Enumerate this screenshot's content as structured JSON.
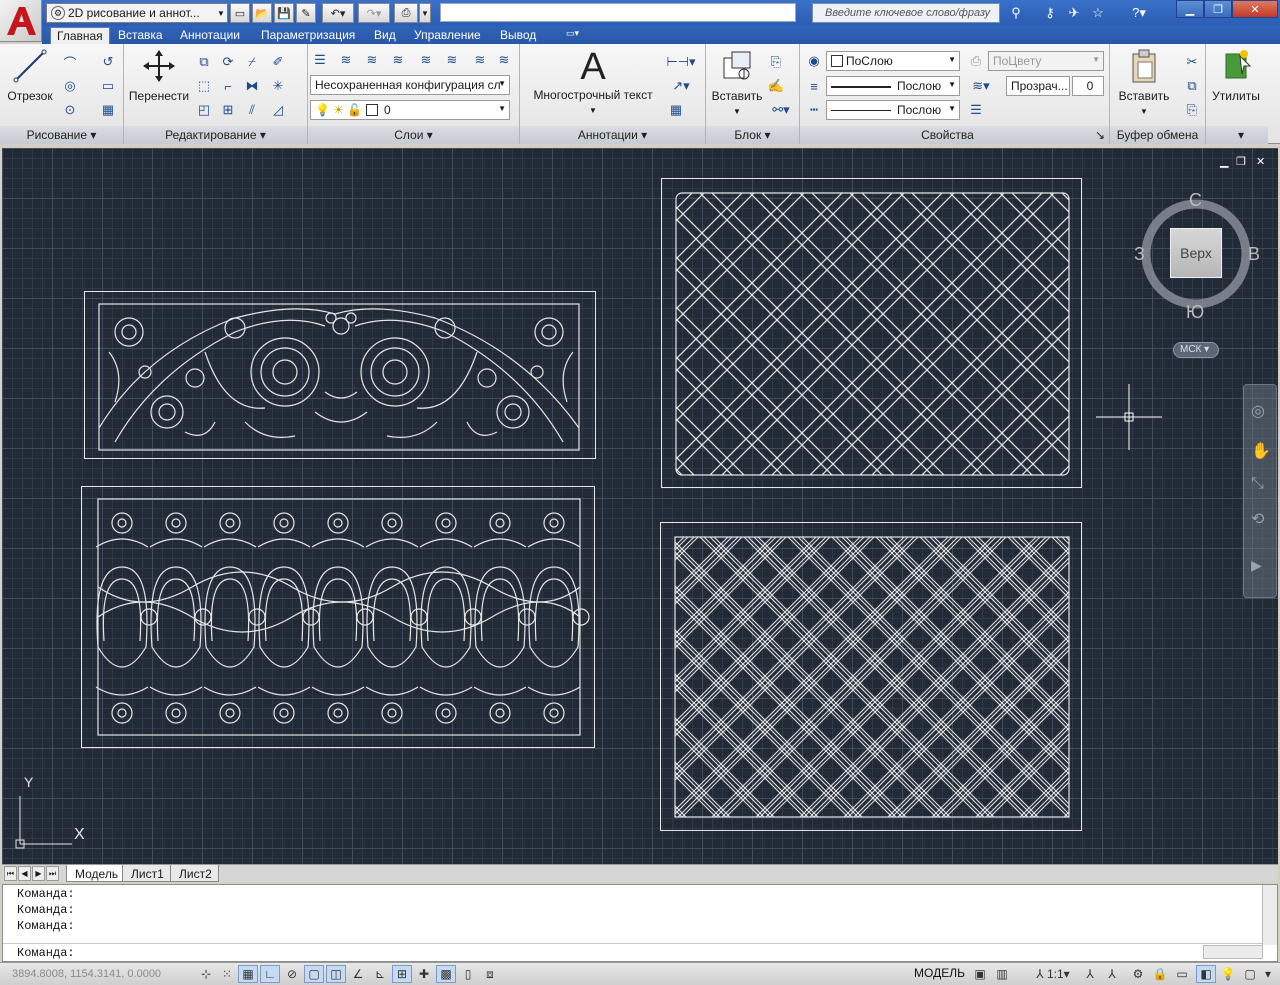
{
  "title_bar": {
    "workspace": "2D рисование и аннот...",
    "search_placeholder": "Введите ключевое слово/фразу"
  },
  "ribbon_tabs": [
    "Главная",
    "Вставка",
    "Аннотации",
    "Параметризация",
    "Вид",
    "Управление",
    "Вывод"
  ],
  "active_tab": "Главная",
  "panels": {
    "draw": {
      "title": "Рисование",
      "line_label": "Отрезок"
    },
    "modify": {
      "title": "Редактирование",
      "move_label": "Перенести"
    },
    "layers": {
      "title": "Слои",
      "layer_state": "Несохраненная конфигурация сл",
      "current_layer": "0"
    },
    "annotation": {
      "title": "Аннотации",
      "mtext_label": "Многострочный текст"
    },
    "block": {
      "title": "Блок",
      "insert_label": "Вставить"
    },
    "properties": {
      "title": "Свойства",
      "color": "ПоСлою",
      "linetype": "Послою",
      "lineweight": "Послою",
      "plot_style": "ПоЦвету",
      "transparency": "Прозрач...",
      "transparency_value": "0"
    },
    "clipboard": {
      "title": "Буфер обмена",
      "paste_label": "Вставить"
    },
    "utilities": {
      "title": "Утилиты"
    }
  },
  "viewcube": {
    "north": "С",
    "south": "Ю",
    "west": "З",
    "east": "В",
    "face": "Верх",
    "ucs": "МСК"
  },
  "ucs_icon": {
    "x": "X",
    "y": "Y"
  },
  "layout_tabs": [
    "Модель",
    "Лист1",
    "Лист2"
  ],
  "active_layout": "Модель",
  "command_history": [
    "Команда:",
    "Команда:",
    "Команда:"
  ],
  "command_prompt": "Команда:",
  "status": {
    "coords": "3894.8008, 1154.3141, 0.0000",
    "model": "МОДЕЛЬ",
    "scale": "1:1"
  },
  "colors": {
    "canvas": "#222a36",
    "linework": "#e6e6e6",
    "titlebar": "#2f63b8"
  },
  "drawing_panels": [
    "floral-scroll-panel",
    "ornamental-loop-panel",
    "diagonal-lattice-panel",
    "double-line-lattice-panel"
  ]
}
